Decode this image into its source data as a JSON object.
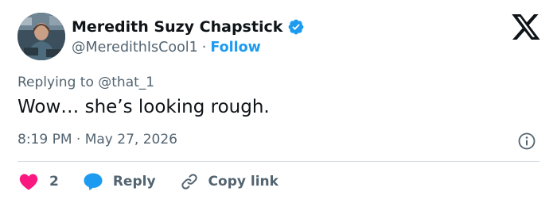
{
  "author": {
    "display_name": "Meredith Suzy Chapstick",
    "handle": "@MeredithIsCool1",
    "separator": "·",
    "follow_label": "Follow",
    "verified_icon": "verified-badge-icon",
    "verified_color": "#1d9bf0"
  },
  "reply": {
    "prefix": "Replying to",
    "mention": "@that_1"
  },
  "tweet": {
    "text": "Wow… she’s looking rough.",
    "time": "8:19 PM",
    "separator": "·",
    "date": "May 27, 2026"
  },
  "actions": {
    "like_count": "2",
    "like_color": "#f91880",
    "reply_label": "Reply",
    "reply_color": "#1d9bf0",
    "copy_label": "Copy link"
  },
  "colors": {
    "text": "#0f1419",
    "secondary": "#536471",
    "accent": "#1d9bf0",
    "divider": "#cfd9de"
  }
}
